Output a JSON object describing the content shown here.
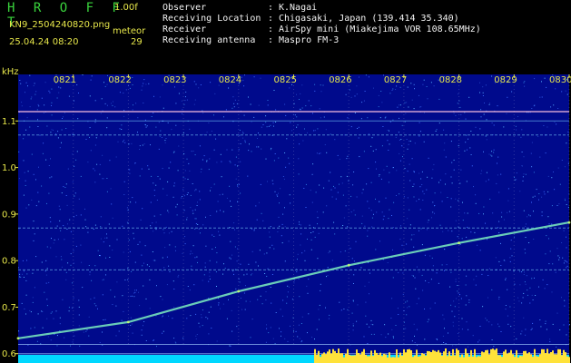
{
  "header": {
    "app_title": "H R O F F T",
    "version": "1.00f",
    "filename": "KN9_2504240820.png",
    "mode": "meteor",
    "datetime": "25.04.24 08:20",
    "count": "29"
  },
  "metadata": [
    {
      "label": "Observer",
      "sep": ":",
      "value": "K.Nagai"
    },
    {
      "label": "Receiving Location",
      "sep": ":",
      "value": "Chigasaki, Japan (139.414 35.340)"
    },
    {
      "label": "Receiver",
      "sep": ":",
      "value": "AirSpy mini (Miakejima VOR 108.65MHz)"
    },
    {
      "label": "Receiving antenna",
      "sep": ":",
      "value": "Maspro FM-3"
    }
  ],
  "chart_data": {
    "type": "heatmap",
    "ylabel": "kHz",
    "y_ticks": [
      "1.1",
      "1.0",
      "0.9",
      "0.8",
      "0.7",
      "0.6"
    ],
    "x_ticks": [
      "0821",
      "0822",
      "0823",
      "0824",
      "0825",
      "0826",
      "0827",
      "0828",
      "0829",
      "0830"
    ],
    "ylim": [
      0.58,
      1.2
    ],
    "xlim": [
      "0820",
      "0830"
    ],
    "background_color": "#000a8c",
    "carriers_khz": [
      1.12,
      1.1,
      1.07,
      0.87,
      0.78,
      0.62,
      0.6
    ],
    "drift_trace": [
      {
        "x": "0820",
        "y": 0.633
      },
      {
        "x": "0822",
        "y": 0.668
      },
      {
        "x": "0824",
        "y": 0.734
      },
      {
        "x": "0826",
        "y": 0.79
      },
      {
        "x": "0828",
        "y": 0.838
      },
      {
        "x": "0830",
        "y": 0.882
      }
    ],
    "colors": {
      "trace": "#7df0c0",
      "carrier": "#7fd6ff",
      "top_carrier": "#e8b0d8",
      "power": "#00d8ff",
      "power_hi": "#ffe23a",
      "labels": "#e6e64a"
    }
  }
}
